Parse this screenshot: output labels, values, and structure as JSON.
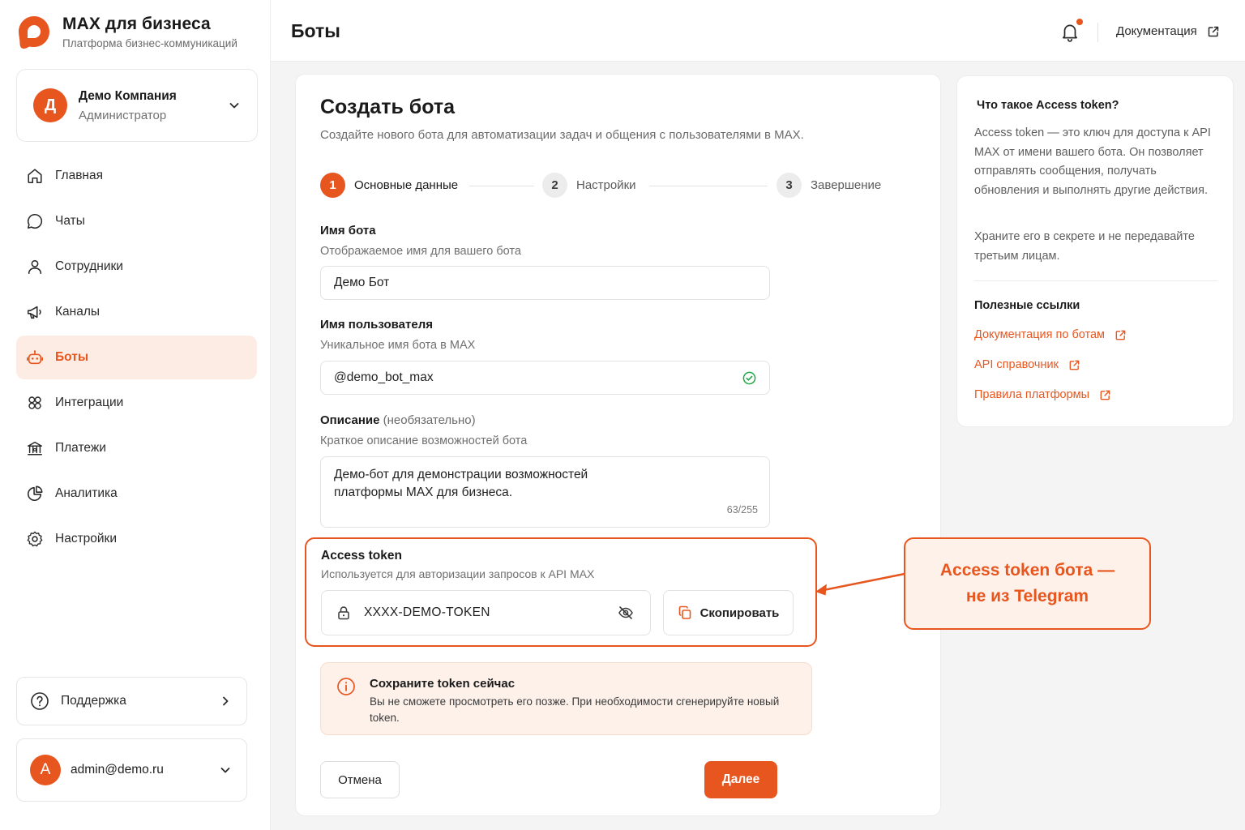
{
  "brand": {
    "title": "MAX для бизнеса",
    "subtitle": "Платформа бизнес-коммуникаций",
    "logo_icon": "max-logo-icon"
  },
  "company": {
    "avatar_letter": "Д",
    "name": "Демо Компания",
    "role": "Администратор"
  },
  "nav": {
    "items": [
      {
        "label": "Главная",
        "icon": "home-icon"
      },
      {
        "label": "Чаты",
        "icon": "chat-icon"
      },
      {
        "label": "Сотрудники",
        "icon": "user-icon"
      },
      {
        "label": "Каналы",
        "icon": "megaphone-icon"
      },
      {
        "label": "Боты",
        "icon": "bot-icon",
        "active": true
      },
      {
        "label": "Интеграции",
        "icon": "puzzle-icon"
      },
      {
        "label": "Платежи",
        "icon": "bank-icon"
      },
      {
        "label": "Аналитика",
        "icon": "pie-chart-icon"
      },
      {
        "label": "Настройки",
        "icon": "gear-icon"
      }
    ]
  },
  "support": {
    "label": "Поддержка"
  },
  "user": {
    "avatar_letter": "A",
    "email": "admin@demo.ru"
  },
  "header": {
    "title": "Боты",
    "docs_label": "Документация"
  },
  "form": {
    "title": "Создать бота",
    "subtitle": "Создайте нового бота для автоматизации задач и общения с пользователями в MAX.",
    "steps": [
      {
        "num": "1",
        "label": "Основные данные",
        "active": true
      },
      {
        "num": "2",
        "label": "Настройки"
      },
      {
        "num": "3",
        "label": "Завершение"
      }
    ],
    "name": {
      "label": "Имя бота",
      "hint": "Отображаемое имя для вашего бота",
      "value": "Демо Бот"
    },
    "username": {
      "label": "Имя пользователя",
      "hint": "Уникальное имя бота в MAX",
      "value": "@demo_bot_max"
    },
    "description": {
      "label": "Описание",
      "optional": "(необязательно)",
      "hint": "Краткое описание возможностей бота",
      "line1": "Демо-бот для демонстрации возможностей",
      "line2": "платформы MAX для бизнеса.",
      "counter": "63/255"
    },
    "token": {
      "label": "Access token",
      "hint": "Используется для авторизации запросов к API MAX",
      "value": "XXXX-DEMO-TOKEN",
      "copy_label": "Скопировать"
    },
    "warning": {
      "title": "Сохраните token сейчас",
      "text": "Вы не сможете просмотреть его позже. При необходимости сгенерируйте новый token."
    },
    "cancel_label": "Отмена",
    "next_label": "Далее"
  },
  "info": {
    "title": "Что такое Access token?",
    "p1": "Access token — это ключ для доступа к API MAX от имени вашего бота. Он позволяет отправлять сообщения, получать обновления и выполнять другие действия.",
    "p2": "Храните его в секрете и не передавайте третьим лицам.",
    "links_title": "Полезные ссылки",
    "links": [
      {
        "label": "Документация по ботам"
      },
      {
        "label": "API справочник"
      },
      {
        "label": "Правила платформы"
      }
    ]
  },
  "callout": {
    "line1": "Access token бота —",
    "line2": "не из Telegram"
  },
  "colors": {
    "accent": "#e8561f",
    "accent_soft": "#fdece4",
    "success": "#22a745"
  }
}
